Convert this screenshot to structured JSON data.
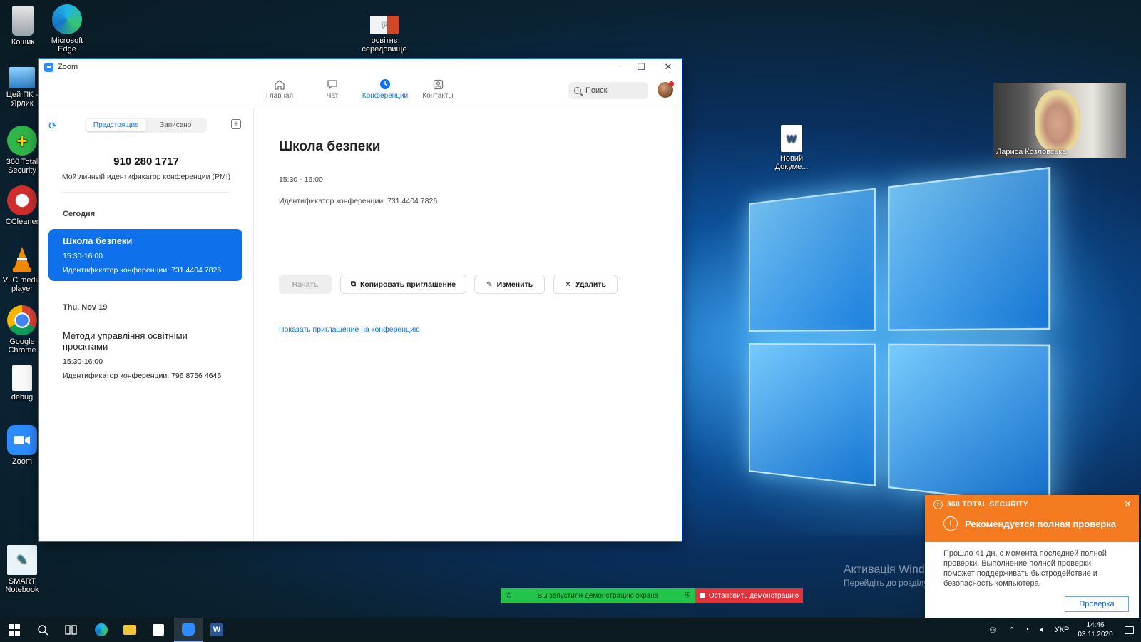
{
  "desktop": {
    "icons": [
      {
        "label": "Кошик"
      },
      {
        "label": "Microsoft Edge"
      },
      {
        "label": "освітнє середовище"
      },
      {
        "label": "Цей ПК - Ярлик"
      },
      {
        "label": "360 Total Security"
      },
      {
        "label": "CCleaner"
      },
      {
        "label": "VLC media player"
      },
      {
        "label": "Google Chrome"
      },
      {
        "label": "debug"
      },
      {
        "label": "Zoom"
      },
      {
        "label": "SMART Notebook"
      },
      {
        "label": "Новий Докуме..."
      }
    ]
  },
  "zoom": {
    "window_title": "Zoom",
    "tabs": [
      {
        "label": "Главная",
        "icon": "home-icon"
      },
      {
        "label": "Чат",
        "icon": "chat-icon"
      },
      {
        "label": "Конференции",
        "icon": "clock-icon"
      },
      {
        "label": "Контакты",
        "icon": "contacts-icon"
      }
    ],
    "active_tab": "Конференции",
    "search_placeholder": "Поиск",
    "segments": {
      "upcoming": "Предстоящие",
      "recorded": "Записано"
    },
    "pmi": {
      "number": "910 280 1717",
      "label": "Мой личный идентификатор конференции (PMI)"
    },
    "sections": [
      {
        "header": "Сегодня",
        "meetings": [
          {
            "title": "Школа безпеки",
            "time": "15:30-16:00",
            "id_line": "Идентификатор конференции: 731 4404 7826",
            "selected": true
          }
        ]
      },
      {
        "header": "Thu, Nov 19",
        "meetings": [
          {
            "title": "Методи управління освітніми проєктами",
            "time": "15:30-16:00",
            "id_line": "Идентификатор конференции: 796 8756 4645",
            "selected": false
          }
        ]
      }
    ],
    "detail": {
      "title": "Школа безпеки",
      "time": "15:30 - 16:00",
      "id_line": "Идентификатор конференции: 731 4404 7826",
      "buttons": {
        "start": "Начать",
        "copy": "Копировать приглашение",
        "edit": "Изменить",
        "delete": "Удалить"
      },
      "show_invite": "Показать приглашение на конференцию"
    },
    "accent": "#0e71eb"
  },
  "video_tile": {
    "name": "Лариса Козловська"
  },
  "activation": {
    "line1": "Активація Windows",
    "line2": "Перейдіть до розділу \"Настройки\", щоб активувати Windows."
  },
  "share_bar": {
    "status": "Вы запустили демонстрацию экрана",
    "stop": "Остановить демонстрацию"
  },
  "notification": {
    "brand": "360 TOTAL SECURITY",
    "title": "Рекомендуется полная проверка",
    "body": "Прошло 41 дн. с момента последней полной проверки. Выполнение полной проверки поможет поддерживать быстродействие и безопасность компьютера.",
    "action": "Проверка",
    "accent": "#f47b20"
  },
  "taskbar": {
    "lang": "УКР",
    "time": "14:46",
    "date": "03.11.2020"
  }
}
